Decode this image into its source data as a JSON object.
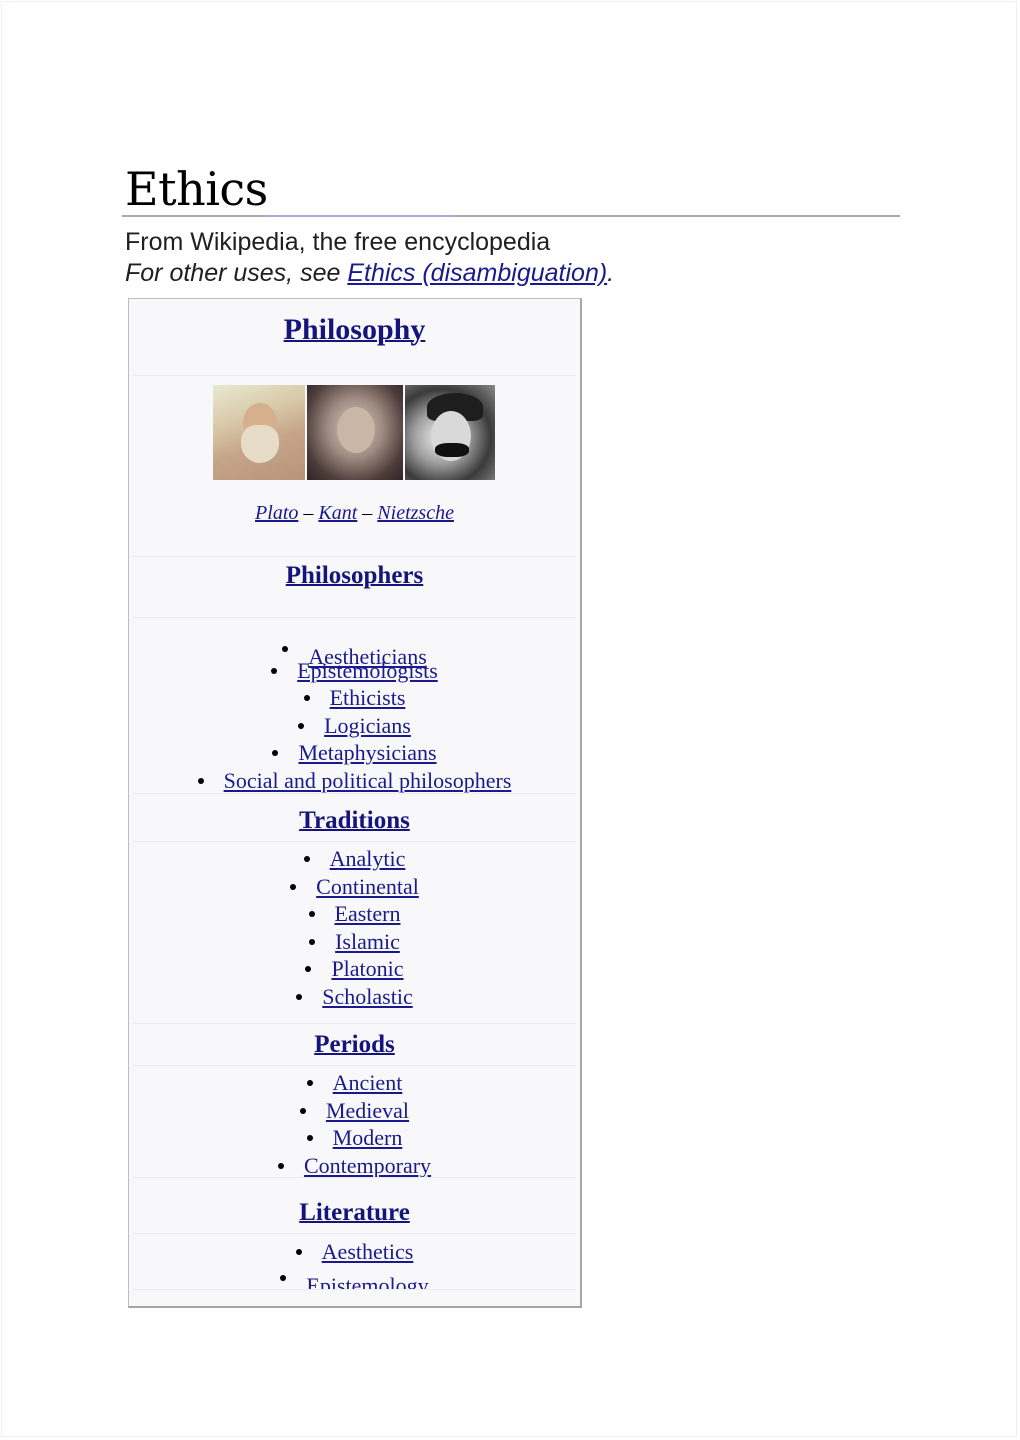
{
  "article": {
    "title": "Ethics",
    "subtitle": "From Wikipedia, the free encyclopedia",
    "hatnote": {
      "prefix": "For other uses, see ",
      "link": "Ethics (disambiguation)",
      "suffix": "."
    }
  },
  "infobox": {
    "heading": "Philosophy",
    "image_alt": "Portraits of Plato, Kant and Nietzsche",
    "caption": {
      "names": [
        "Plato",
        "Kant",
        "Nietzsche"
      ],
      "separator": " – "
    },
    "sections": [
      {
        "heading": "Philosophers",
        "items": [
          "Aestheticians",
          "Epistemologists",
          "Ethicists",
          "Logicians",
          "Metaphysicians",
          "Social and political philosophers"
        ]
      },
      {
        "heading": "Traditions",
        "items": [
          "Analytic",
          "Continental",
          "Eastern",
          "Islamic",
          "Platonic",
          "Scholastic"
        ]
      },
      {
        "heading": "Periods",
        "items": [
          "Ancient",
          "Medieval",
          "Modern",
          "Contemporary"
        ]
      },
      {
        "heading": "Literature",
        "items": [
          "Aesthetics",
          "Epistemology"
        ]
      }
    ]
  },
  "colors": {
    "link": "#1a1a8c",
    "infobox_bg": "#f8f8fa",
    "rule": "#a9a9a9"
  }
}
